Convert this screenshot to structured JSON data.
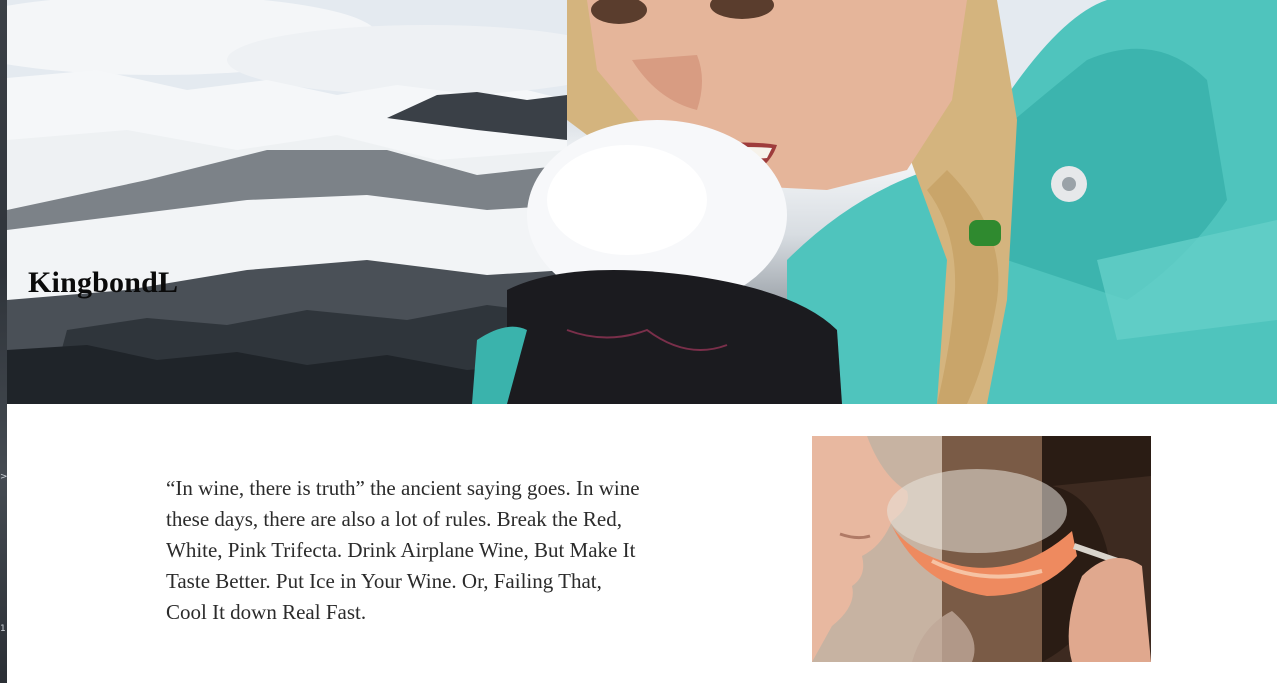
{
  "hero": {
    "title": "KingbondL",
    "image": "woman-eating-snow-on-mountain-photo"
  },
  "article": {
    "quote": "“In wine, there is truth” the ancient saying goes. In wine these days, there are also a lot of rules. Break the Red, White, Pink Trifecta. Drink Airplane Wine, But Make It Taste Better. Put Ice in Your Wine. Or, Failing That, Cool It down Real Fast.",
    "image": "person-smelling-rose-wine-glass-photo"
  },
  "sidebar_strip": {
    "marks": [
      ">",
      "1"
    ]
  },
  "colors": {
    "jacket": "#4fc4bd",
    "text": "#2b2b2b",
    "title": "#0b0b0b",
    "wine": "#e9845c"
  }
}
